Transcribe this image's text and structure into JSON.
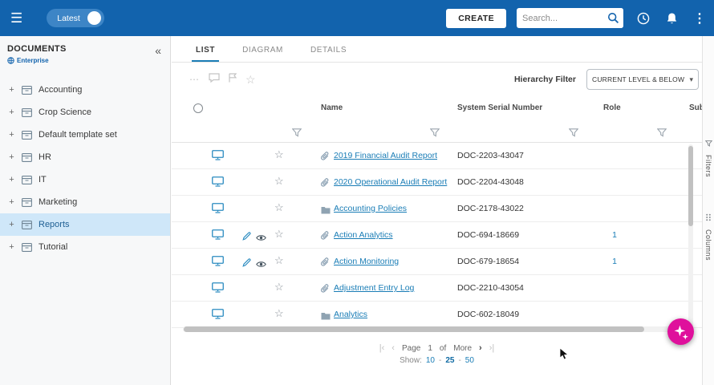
{
  "colors": {
    "topbar_blue": "#1263ad",
    "pill_blue": "#3d85c6",
    "accent_blue": "#1a7db6",
    "link_blue": "#1a7db6",
    "selected_item_bg": "#cfe7f9",
    "fab_magenta": "#df109c"
  },
  "icons": {
    "hamburger": "☰",
    "collapse": "«",
    "expander": "+",
    "dots": "⋮",
    "ellipsis": "⋯",
    "star": "☆",
    "caret": "▾",
    "first": "|‹",
    "prev": "‹",
    "next": "›",
    "last": "›|",
    "dash": "-"
  },
  "topbar": {
    "latest_label": "Latest",
    "create_label": "CREATE",
    "search_placeholder": "Search..."
  },
  "sidebar": {
    "title": "DOCUMENTS",
    "badge": "Enterprise",
    "items": [
      {
        "label": "Accounting"
      },
      {
        "label": "Crop Science"
      },
      {
        "label": "Default template set"
      },
      {
        "label": "HR"
      },
      {
        "label": "IT"
      },
      {
        "label": "Marketing"
      },
      {
        "label": "Reports"
      },
      {
        "label": "Tutorial"
      }
    ]
  },
  "main": {
    "tabs": [
      {
        "label": "LIST"
      },
      {
        "label": "DIAGRAM"
      },
      {
        "label": "DETAILS"
      }
    ],
    "hierarchy_filter": {
      "label": "Hierarchy Filter",
      "value": "CURRENT LEVEL & BELOW"
    },
    "table": {
      "columns": {
        "name": "Name",
        "serial": "System Serial Number",
        "role": "Role",
        "sub": "Sub"
      },
      "rows": [
        {
          "name": "2019 Financial Audit Report",
          "serial": "DOC-2203-43047",
          "role": "",
          "is_document": true,
          "is_folder": false,
          "has_edit": false
        },
        {
          "name": "2020 Operational Audit Report",
          "serial": "DOC-2204-43048",
          "role": "",
          "is_document": true,
          "is_folder": false,
          "has_edit": false
        },
        {
          "name": "Accounting Policies",
          "serial": "DOC-2178-43022",
          "role": "",
          "is_document": false,
          "is_folder": true,
          "has_edit": false
        },
        {
          "name": "Action Analytics",
          "serial": "DOC-694-18669",
          "role": "1",
          "is_document": true,
          "is_folder": false,
          "has_edit": true
        },
        {
          "name": "Action Monitoring",
          "serial": "DOC-679-18654",
          "role": "1",
          "is_document": true,
          "is_folder": false,
          "has_edit": true
        },
        {
          "name": "Adjustment Entry Log",
          "serial": "DOC-2210-43054",
          "role": "",
          "is_document": true,
          "is_folder": false,
          "has_edit": false
        },
        {
          "name": "Analytics",
          "serial": "DOC-602-18049",
          "role": "",
          "is_document": false,
          "is_folder": true,
          "has_edit": false
        }
      ]
    },
    "pagination": {
      "page_label": "Page",
      "current_page": "1",
      "of_label": "of",
      "total_pages": "More",
      "show_label": "Show:",
      "sizes": [
        "10",
        "25",
        "50"
      ],
      "active_size": "25"
    }
  },
  "right_rail": {
    "filters_label": "Filters",
    "columns_label": "Columns"
  }
}
